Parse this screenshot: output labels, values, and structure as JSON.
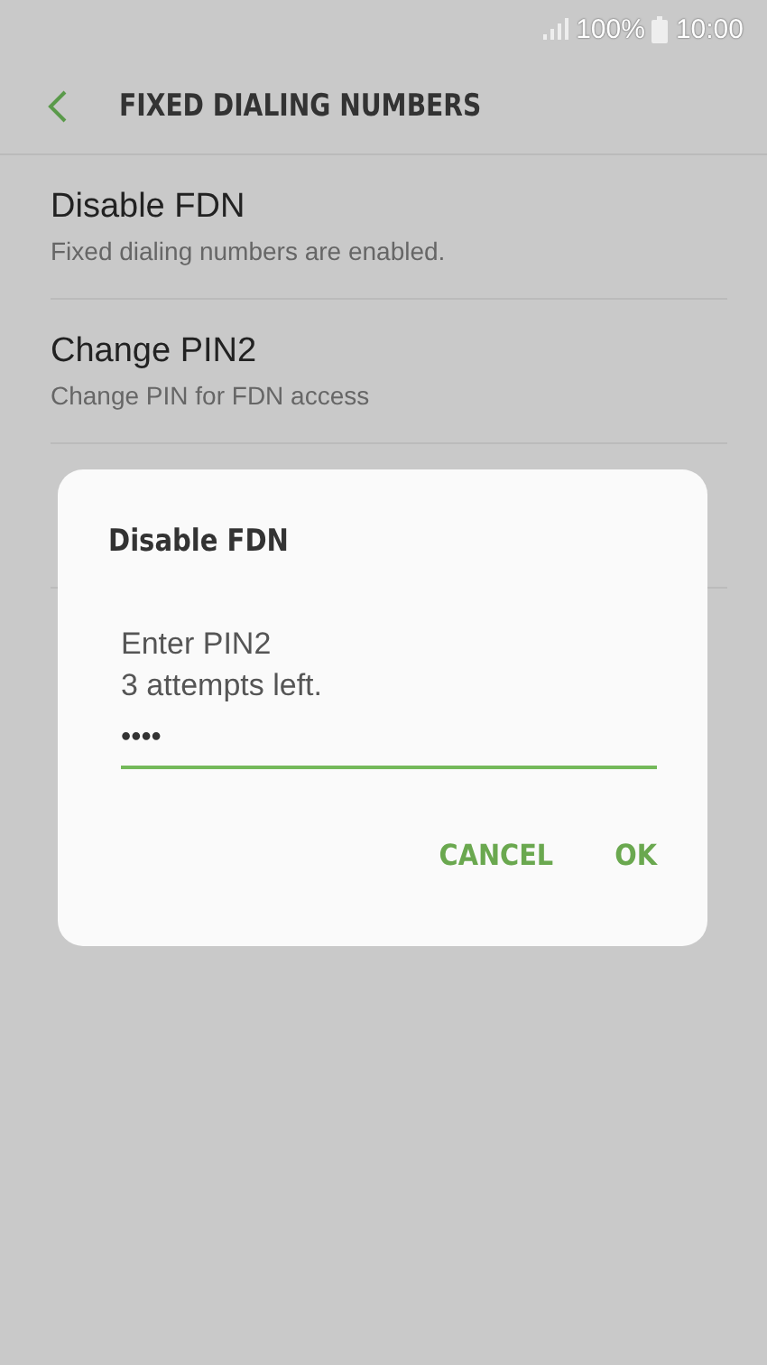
{
  "status_bar": {
    "battery": "100%",
    "time": "10:00"
  },
  "header": {
    "title": "FIXED DIALING NUMBERS"
  },
  "items": [
    {
      "title": "Disable FDN",
      "subtitle": "Fixed dialing numbers are enabled."
    },
    {
      "title": "Change PIN2",
      "subtitle": "Change PIN for FDN access"
    }
  ],
  "dialog": {
    "title": "Disable FDN",
    "message": [
      "Enter PIN2",
      "3 attempts left."
    ],
    "pin_field": {
      "value": "••••"
    },
    "buttons": [
      "CANCEL",
      "OK"
    ]
  }
}
